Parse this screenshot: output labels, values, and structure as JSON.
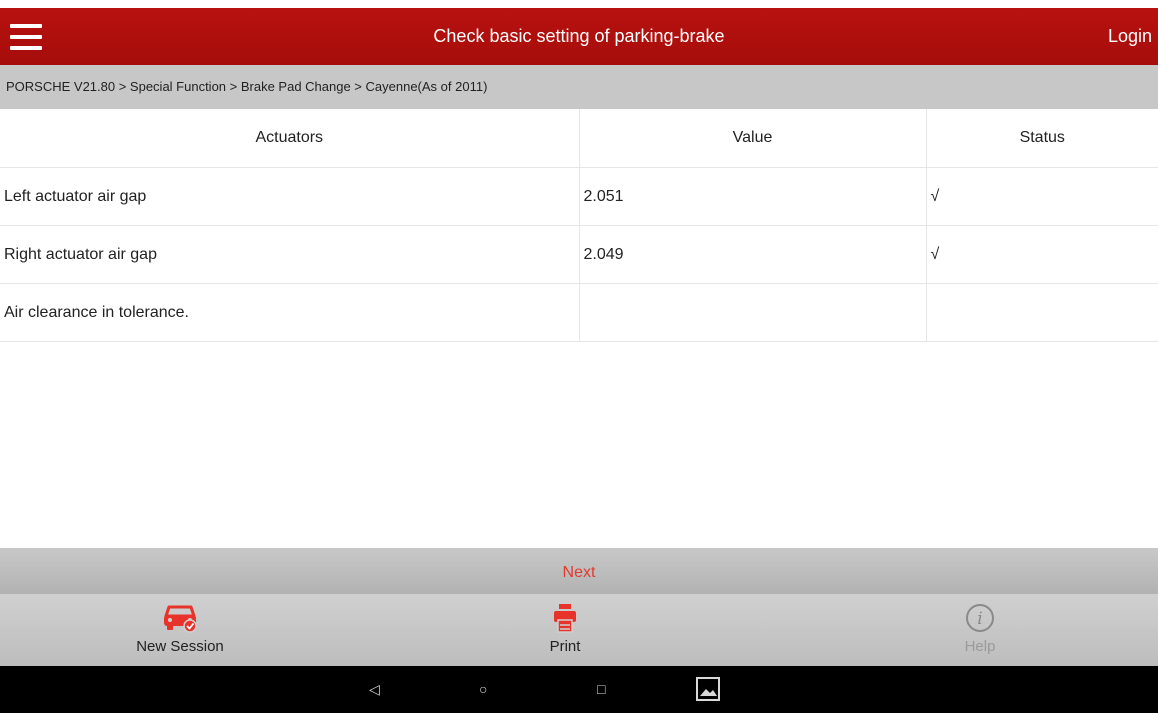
{
  "header": {
    "title": "Check basic setting of parking-brake",
    "login_label": "Login"
  },
  "breadcrumb": "PORSCHE V21.80 > Special Function > Brake Pad Change > Cayenne(As of 2011)",
  "table": {
    "columns": [
      "Actuators",
      "Value",
      "Status"
    ],
    "rows": [
      {
        "actuator": "Left actuator air gap",
        "value": "2.051",
        "status": "√"
      },
      {
        "actuator": "Right actuator air gap",
        "value": "2.049",
        "status": "√"
      },
      {
        "actuator": "Air clearance in tolerance.",
        "value": "",
        "status": ""
      }
    ]
  },
  "next_label": "Next",
  "toolbar": {
    "new_session": {
      "label": "New Session",
      "icon": "car-check-icon"
    },
    "print": {
      "label": "Print",
      "icon": "printer-icon"
    },
    "help": {
      "label": "Help",
      "icon": "info-icon"
    }
  },
  "navbar": {
    "back": {
      "glyph": "◁",
      "icon": "back-icon"
    },
    "home": {
      "glyph": "○",
      "icon": "home-icon"
    },
    "recents": {
      "glyph": "□",
      "icon": "recents-icon"
    },
    "screenshot": {
      "icon": "image-icon"
    }
  },
  "colors": {
    "header": "#b8120f",
    "accent": "#e8332a",
    "breadcrumb_bg": "#c7c7c7",
    "toolbar_bg": "#c8c8c8",
    "help_gray": "#9a9a9a"
  }
}
